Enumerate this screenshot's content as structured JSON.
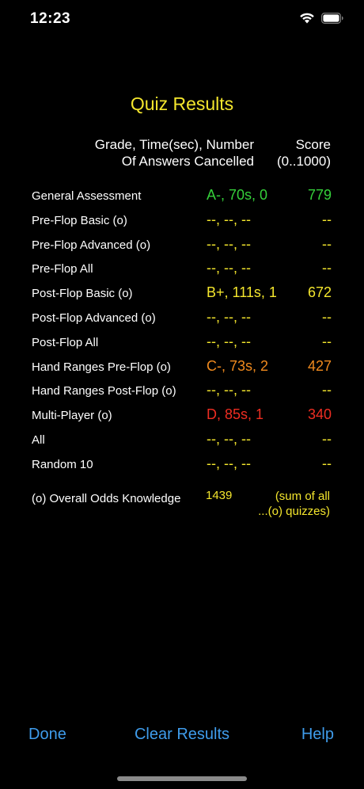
{
  "status_bar": {
    "time": "12:23",
    "icons": [
      "wifi-icon",
      "battery-icon"
    ]
  },
  "title": "Quiz Results",
  "headers": {
    "grade_line1": "Grade, Time(sec), Number",
    "grade_line2": "Of Answers Cancelled",
    "score_line1": "Score",
    "score_line2": "(0..1000)"
  },
  "colors": {
    "background": "#000000",
    "title": "#f4e62d",
    "green": "#35d03a",
    "yellow": "#f4e62d",
    "orange": "#f08a1e",
    "red": "#ee2d22",
    "link_blue": "#3f9ceb"
  },
  "rows": [
    {
      "label": "General Assessment",
      "grade": "A-, 70s, 0",
      "score": "779",
      "color": "#35d03a"
    },
    {
      "label": "Pre-Flop Basic (o)",
      "grade": "--, --, --",
      "score": "--",
      "color": "#f4e62d"
    },
    {
      "label": "Pre-Flop Advanced (o)",
      "grade": "--, --, --",
      "score": "--",
      "color": "#f4e62d"
    },
    {
      "label": "Pre-Flop All",
      "grade": "--, --, --",
      "score": "--",
      "color": "#f4e62d"
    },
    {
      "label": "Post-Flop Basic (o)",
      "grade": "B+, 111s, 1",
      "score": "672",
      "color": "#f4e62d"
    },
    {
      "label": "Post-Flop Advanced (o)",
      "grade": "--, --, --",
      "score": "--",
      "color": "#f4e62d"
    },
    {
      "label": "Post-Flop All",
      "grade": "--, --, --",
      "score": "--",
      "color": "#f4e62d"
    },
    {
      "label": "Hand Ranges Pre-Flop (o)",
      "grade": "C-, 73s, 2",
      "score": "427",
      "color": "#f08a1e"
    },
    {
      "label": "Hand Ranges Post-Flop (o)",
      "grade": "--, --, --",
      "score": "--",
      "color": "#f4e62d"
    },
    {
      "label": "Multi-Player (o)",
      "grade": "D, 85s, 1",
      "score": "340",
      "color": "#ee2d22"
    },
    {
      "label": "All",
      "grade": "--, --, --",
      "score": "--",
      "color": "#f4e62d"
    },
    {
      "label": "Random 10",
      "grade": "--, --, --",
      "score": "--",
      "color": "#f4e62d"
    }
  ],
  "overall": {
    "label": "(o) Overall Odds Knowledge",
    "value": "1439",
    "note_line1": "(sum of all",
    "note_line2": "...(o) quizzes)"
  },
  "toolbar": {
    "done_label": "Done",
    "clear_label": "Clear Results",
    "help_label": "Help"
  }
}
